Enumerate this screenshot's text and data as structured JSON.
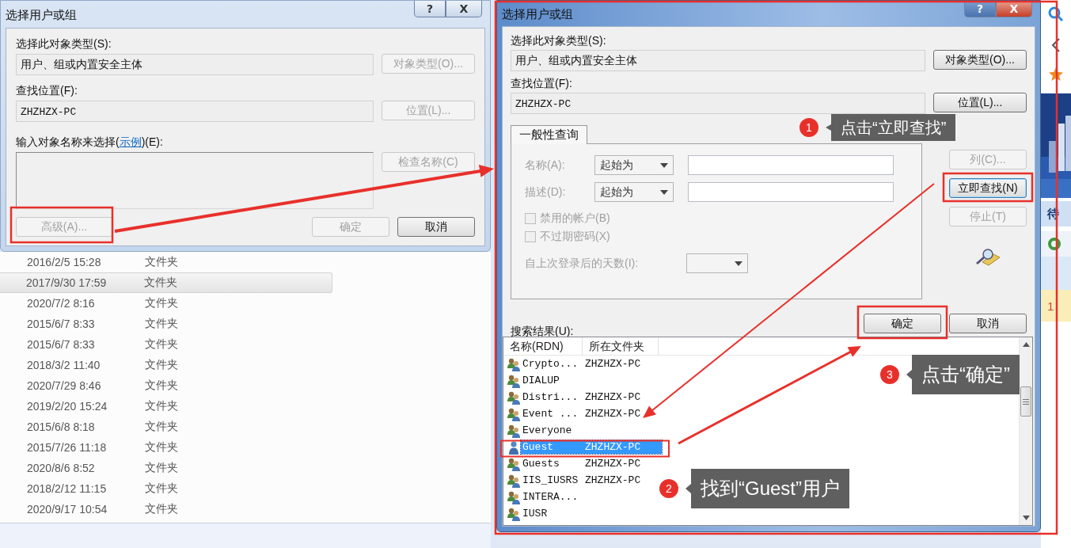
{
  "left_dialog": {
    "title": "选择用户或组",
    "help_button": "?",
    "close_button": "X",
    "object_type": {
      "label": "选择此对象类型(S):",
      "value": "用户、组或内置安全主体",
      "button": {
        "label": "对象类型(O)...",
        "disabled": true
      }
    },
    "location": {
      "label": "查找位置(F):",
      "value": "ZHZHZX-PC",
      "button": {
        "label": "位置(L)...",
        "disabled": true
      }
    },
    "names": {
      "label_start": "输入对象名称来选择(",
      "link": "示例",
      "label_end": ")(E):",
      "button": {
        "label": "检查名称(C)",
        "disabled": true
      }
    },
    "advanced_button": {
      "label": "高级(A)...",
      "disabled": true
    },
    "ok_button": {
      "label": "确定",
      "disabled": true
    },
    "cancel_button": {
      "label": "取消",
      "disabled": false
    }
  },
  "file_list": {
    "rows": [
      {
        "date": "2016/2/5 15:28",
        "type": "文件夹",
        "selected": false
      },
      {
        "date": "2017/9/30 17:59",
        "type": "文件夹",
        "selected": true
      },
      {
        "date": "2020/7/2 8:16",
        "type": "文件夹",
        "selected": false
      },
      {
        "date": "2015/6/7 8:33",
        "type": "文件夹",
        "selected": false
      },
      {
        "date": "2015/6/7 8:33",
        "type": "文件夹",
        "selected": false
      },
      {
        "date": "2018/3/2 11:40",
        "type": "文件夹",
        "selected": false
      },
      {
        "date": "2020/7/29 8:46",
        "type": "文件夹",
        "selected": false
      },
      {
        "date": "2019/2/20 15:24",
        "type": "文件夹",
        "selected": false
      },
      {
        "date": "2015/6/8 8:18",
        "type": "文件夹",
        "selected": false
      },
      {
        "date": "2015/7/26 11:18",
        "type": "文件夹",
        "selected": false
      },
      {
        "date": "2020/8/6 8:52",
        "type": "文件夹",
        "selected": false
      },
      {
        "date": "2018/2/12 11:15",
        "type": "文件夹",
        "selected": false
      },
      {
        "date": "2020/9/17 10:54",
        "type": "文件夹",
        "selected": false
      }
    ]
  },
  "right_dialog": {
    "title": "选择用户或组",
    "help_button": "?",
    "close_button": "X",
    "object_type": {
      "label": "选择此对象类型(S):",
      "value": "用户、组或内置安全主体",
      "button": {
        "label": "对象类型(O)...",
        "disabled": false
      }
    },
    "location": {
      "label": "查找位置(F):",
      "value": "ZHZHZX-PC",
      "button": {
        "label": "位置(L)...",
        "disabled": false
      }
    },
    "tabs": [
      {
        "label": "一般性查询",
        "selected": true
      }
    ],
    "query": {
      "disabled": true,
      "name": {
        "label": "名称(A):",
        "operator": "起始为"
      },
      "description": {
        "label": "描述(D):",
        "operator": "起始为"
      },
      "checkboxes": [
        {
          "label": "禁用的帐户(B)",
          "checked": false
        },
        {
          "label": "不过期密码(X)",
          "checked": false
        }
      ],
      "days": {
        "label": "自上次登录后的天数(I):"
      }
    },
    "side_buttons": [
      {
        "label": "列(C)...",
        "disabled": true,
        "focused": false
      },
      {
        "label": "立即查找(N)",
        "disabled": false,
        "focused": true
      },
      {
        "label": "停止(T)",
        "disabled": true,
        "focused": false
      }
    ],
    "ok_button": {
      "label": "确定",
      "disabled": false
    },
    "cancel_button": {
      "label": "取消",
      "disabled": false
    },
    "results": {
      "label": "搜索结果(U):",
      "columns": [
        "名称(RDN)",
        "所在文件夹"
      ],
      "rows": [
        {
          "kind": "group",
          "name": "Crypto...",
          "folder": "ZHZHZX-PC",
          "selected": false
        },
        {
          "kind": "group",
          "name": "DIALUP",
          "selected": false
        },
        {
          "kind": "group",
          "name": "Distri...",
          "folder": "ZHZHZX-PC",
          "selected": false
        },
        {
          "kind": "group",
          "name": "Event ...",
          "folder": "ZHZHZX-PC",
          "selected": false
        },
        {
          "kind": "group",
          "name": "Everyone",
          "selected": false
        },
        {
          "kind": "user",
          "name": "Guest",
          "folder": "ZHZHZX-PC",
          "selected": true
        },
        {
          "kind": "group",
          "name": "Guests",
          "folder": "ZHZHZX-PC",
          "selected": false
        },
        {
          "kind": "group",
          "name": "IIS_IUSRS",
          "folder": "ZHZHZX-PC",
          "selected": false
        },
        {
          "kind": "group",
          "name": "INTERA...",
          "selected": false
        },
        {
          "kind": "group",
          "name": "IUSR",
          "selected": false
        }
      ]
    }
  },
  "annotations": [
    {
      "number": "1",
      "text": "点击“立即查找”"
    },
    {
      "number": "2",
      "text": "找到“Guest”用户"
    },
    {
      "number": "3",
      "text": "点击“确定”"
    }
  ],
  "side_strip": {
    "texts": [
      "待",
      "1"
    ]
  }
}
